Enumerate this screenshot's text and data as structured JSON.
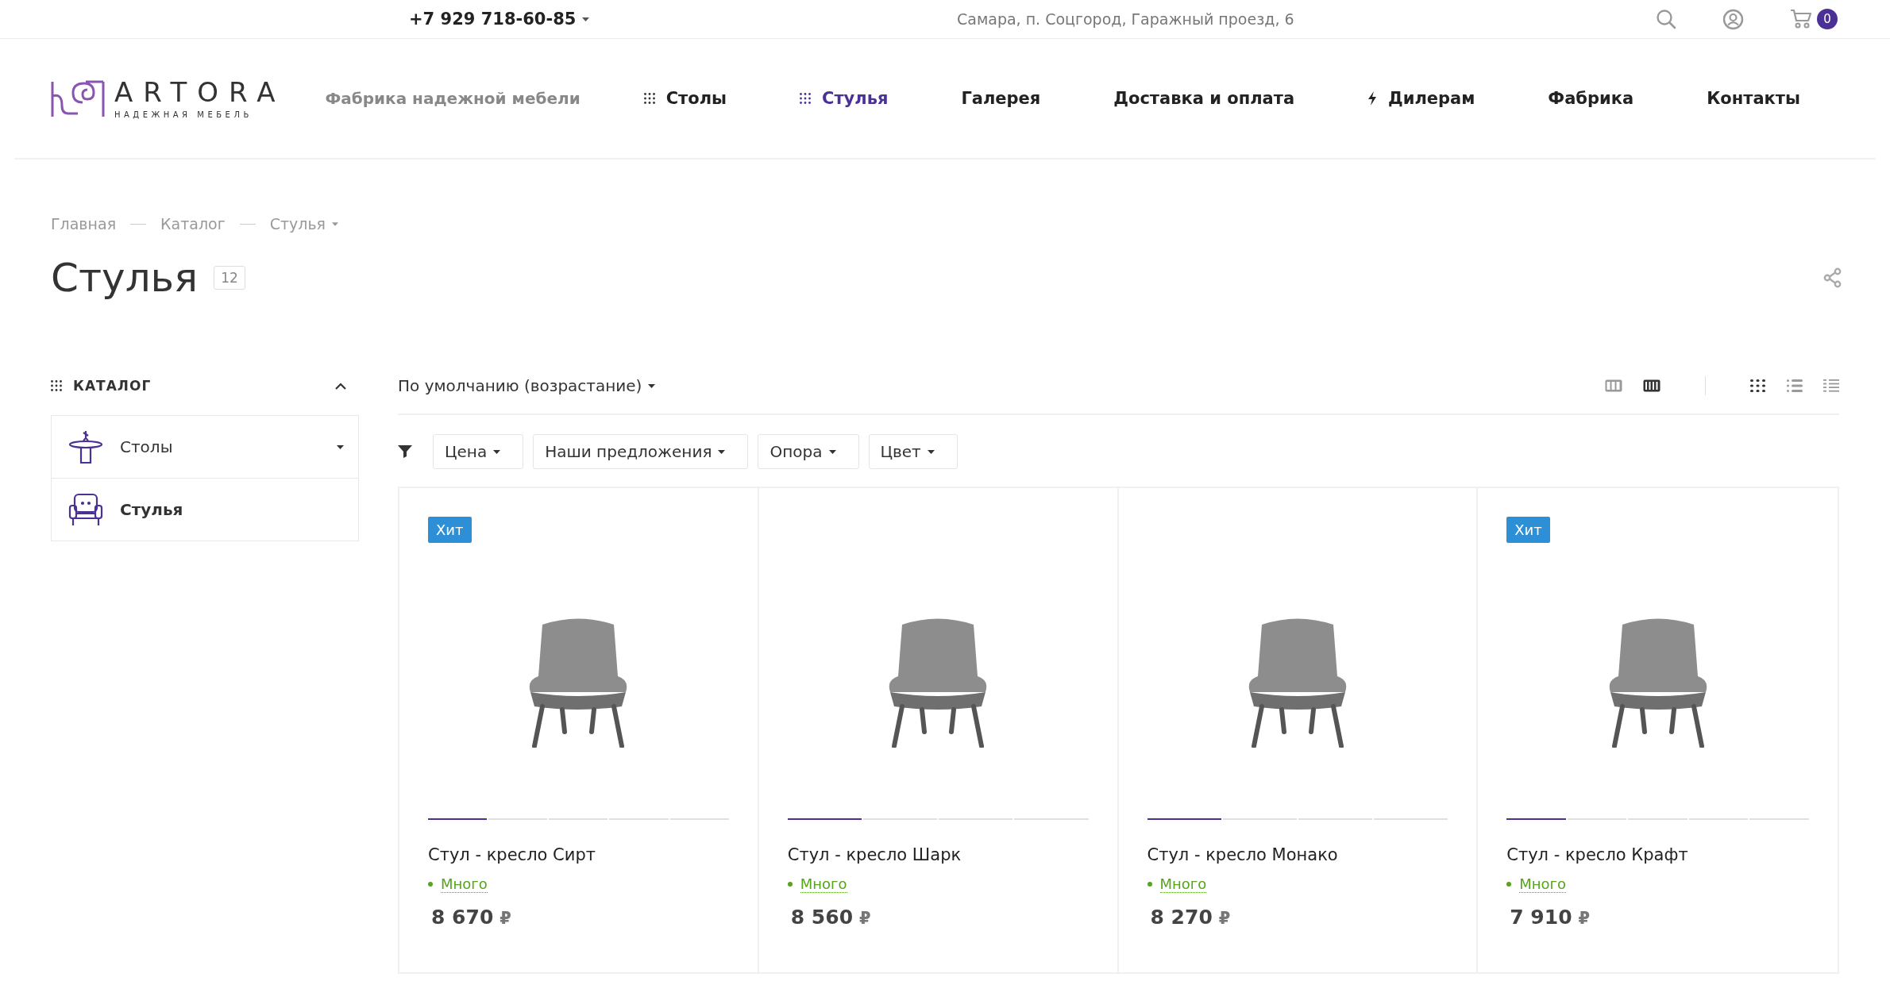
{
  "top_bar": {
    "phone": "+7 929 718-60-85",
    "address": "Самара, п. Соцгород, Гаражный проезд, 6",
    "cart_count": "0"
  },
  "header": {
    "logo": {
      "name": "ARTORA",
      "tagline": "НАДЕЖНАЯ МЕБЕЛЬ"
    },
    "slogan": "Фабрика надежной мебели",
    "nav": [
      {
        "label": "Столы",
        "kind": "grid",
        "selected": false
      },
      {
        "label": "Стулья",
        "kind": "grid",
        "selected": true
      },
      {
        "label": "Галерея",
        "kind": "plain",
        "selected": false
      },
      {
        "label": "Доставка и оплата",
        "kind": "plain",
        "selected": false
      },
      {
        "label": "Дилерам",
        "kind": "bolt",
        "selected": false
      },
      {
        "label": "Фабрика",
        "kind": "plain",
        "selected": false
      },
      {
        "label": "Контакты",
        "kind": "plain",
        "selected": false
      }
    ]
  },
  "breadcrumbs": [
    {
      "label": "Главная",
      "dropdown": false
    },
    {
      "label": "Каталог",
      "dropdown": false
    },
    {
      "label": "Стулья",
      "dropdown": true
    }
  ],
  "page": {
    "title": "Стулья",
    "count": "12"
  },
  "sidebar": {
    "title": "КАТАЛОГ",
    "expanded": true,
    "items": [
      {
        "label": "Столы",
        "kind": "table",
        "selected": false,
        "dropdown": true
      },
      {
        "label": "Стулья",
        "kind": "armchair",
        "selected": true,
        "dropdown": false
      }
    ]
  },
  "toolbar": {
    "sort": "По умолчанию (возрастание)",
    "columns": [
      {
        "kind": "three",
        "selected": false
      },
      {
        "kind": "four",
        "selected": true
      }
    ],
    "layouts": [
      {
        "kind": "tiles",
        "selected": true
      },
      {
        "kind": "list",
        "selected": false
      },
      {
        "kind": "table",
        "selected": false
      }
    ]
  },
  "filters": [
    "Цена",
    "Наши предложения",
    "Опора",
    "Цвет"
  ],
  "products": [
    {
      "badge": "Хит",
      "name": "Стул - кресло Сирт",
      "stock": "Много",
      "price": "8 670",
      "currency": "₽",
      "slides": [
        {
          "selected": true
        },
        {
          "selected": false
        },
        {
          "selected": false
        },
        {
          "selected": false
        },
        {
          "selected": false
        }
      ]
    },
    {
      "name": "Стул - кресло Шарк",
      "stock": "Много",
      "price": "8 560",
      "currency": "₽",
      "slides": [
        {
          "selected": true
        },
        {
          "selected": false
        },
        {
          "selected": false
        },
        {
          "selected": false
        }
      ]
    },
    {
      "name": "Стул - кресло Монако",
      "stock": "Много",
      "price": "8 270",
      "currency": "₽",
      "slides": [
        {
          "selected": true
        },
        {
          "selected": false
        },
        {
          "selected": false
        },
        {
          "selected": false
        }
      ]
    },
    {
      "badge": "Хит",
      "name": "Стул - кресло Крафт",
      "stock": "Много",
      "price": "7 910",
      "currency": "₽",
      "slides": [
        {
          "selected": true
        },
        {
          "selected": false
        },
        {
          "selected": false
        },
        {
          "selected": false
        },
        {
          "selected": false
        }
      ]
    }
  ]
}
